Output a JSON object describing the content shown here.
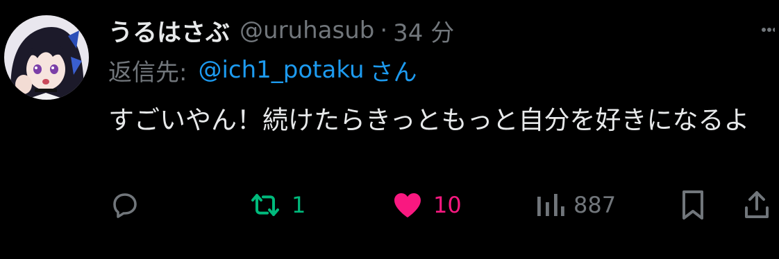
{
  "tweet": {
    "author": {
      "display_name": "うるはさぶ",
      "handle": "@uruhasub",
      "avatar": "anime-character-avatar"
    },
    "separator": "·",
    "time": "34 分",
    "reply_to": {
      "prefix": "返信先:",
      "user": "@ich1_potaku",
      "suffix": "さん"
    },
    "text": "すごいやん！続けたらきっともっと自分を好きになるよ",
    "actions": {
      "reply": {
        "icon": "reply-icon"
      },
      "retweet": {
        "icon": "retweet-icon",
        "count": "1",
        "color": "#00ba7c"
      },
      "like": {
        "icon": "heart-icon",
        "count": "10",
        "color": "#f91880",
        "active": true
      },
      "views": {
        "icon": "views-icon",
        "count": "887"
      },
      "bookmark": {
        "icon": "bookmark-icon"
      },
      "share": {
        "icon": "share-icon"
      }
    },
    "more_icon": "more-icon"
  },
  "colors": {
    "background": "#000000",
    "primary_text": "#e7e9ea",
    "secondary_text": "#71767b",
    "link": "#1d9bf0"
  }
}
